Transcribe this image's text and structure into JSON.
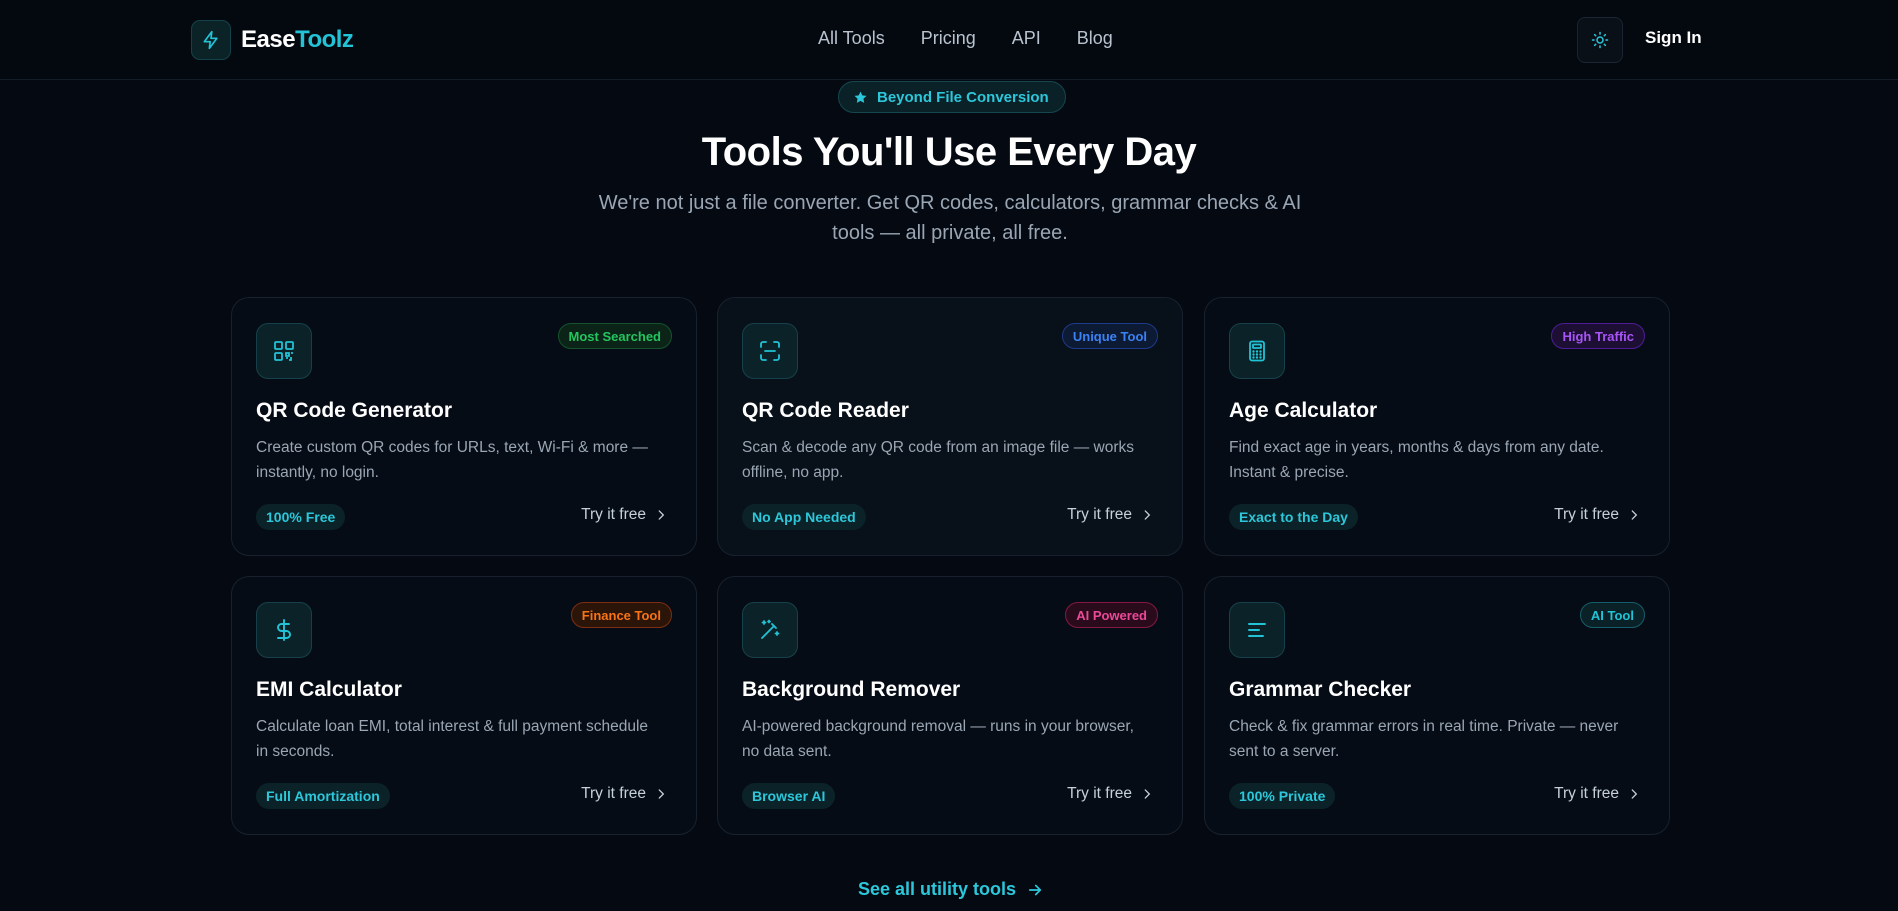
{
  "header": {
    "logo": {
      "part1": "Ease",
      "part2": "Toolz",
      "icon": "lightning-icon"
    },
    "nav": [
      "All Tools",
      "Pricing",
      "API",
      "Blog"
    ],
    "theme_icon": "sun-icon",
    "sign_in": "Sign In"
  },
  "hero": {
    "pill": "Beyond File Conversion",
    "pill_icon": "star-icon",
    "title": "Tools You'll Use Every Day",
    "subtitle": "We're not just a file converter. Get QR codes, calculators, grammar checks & AI tools — all private, all free."
  },
  "cards": [
    {
      "icon": "qr-code-icon",
      "badge": "Most Searched",
      "title": "QR Code Generator",
      "desc": "Create custom QR codes for URLs, text, Wi-Fi & more — instantly, no login.",
      "tag": "100% Free",
      "cta": "Try it free"
    },
    {
      "icon": "scan-icon",
      "badge": "Unique Tool",
      "title": "QR Code Reader",
      "desc": "Scan & decode any QR code from an image file — works offline, no app.",
      "tag": "No App Needed",
      "cta": "Try it free"
    },
    {
      "icon": "calculator-icon",
      "badge": "High Traffic",
      "title": "Age Calculator",
      "desc": "Find exact age in years, months & days from any date. Instant & precise.",
      "tag": "Exact to the Day",
      "cta": "Try it free"
    },
    {
      "icon": "dollar-icon",
      "badge": "Finance Tool",
      "title": "EMI Calculator",
      "desc": "Calculate loan EMI, total interest & full payment schedule in seconds.",
      "tag": "Full Amortization",
      "cta": "Try it free"
    },
    {
      "icon": "magic-wand-icon",
      "badge": "AI Powered",
      "title": "Background Remover",
      "desc": "AI-powered background removal — runs in your browser, no data sent.",
      "tag": "Browser AI",
      "cta": "Try it free"
    },
    {
      "icon": "text-lines-icon",
      "badge": "AI Tool",
      "title": "Grammar Checker",
      "desc": "Check & fix grammar errors in real time. Private — never sent to a server.",
      "tag": "100% Private",
      "cta": "Try it free"
    }
  ],
  "badge_colors": {
    "most_searched": "#22c55e",
    "unique_tool": "#3b82f6",
    "high_traffic": "#a855f7",
    "finance_tool": "#f97316",
    "ai_powered": "#ec4899",
    "ai_tool": "#22c3d6"
  },
  "accent": "#22c3d6",
  "see_all": "See all utility tools"
}
